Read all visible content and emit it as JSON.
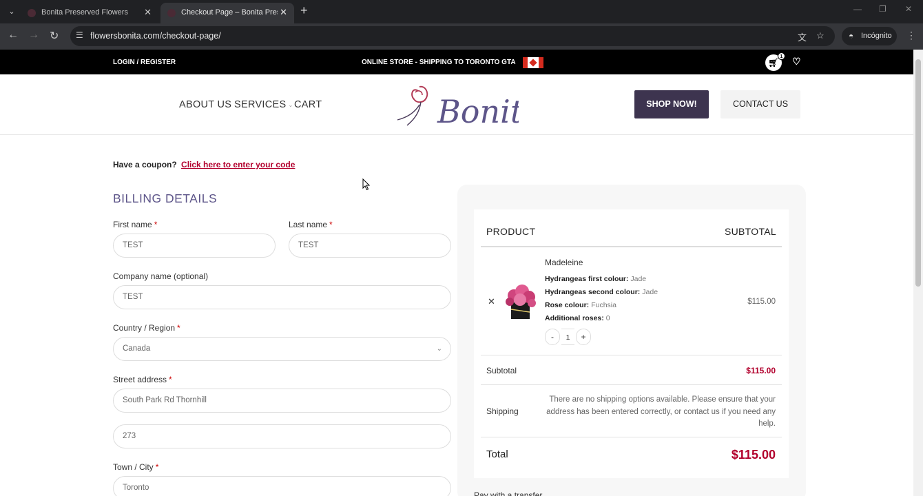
{
  "browser": {
    "tabs": [
      {
        "title": "Bonita Preserved Flowers",
        "active": false
      },
      {
        "title": "Checkout Page – Bonita Preserved Flowers",
        "active": true
      }
    ],
    "url": "flowersbonita.com/checkout-page/",
    "incognito_label": "Incógnito"
  },
  "topbar": {
    "login": "LOGIN / REGISTER",
    "promo": "ONLINE STORE - SHIPPING TO TORONTO GTA",
    "cart_count": "1"
  },
  "header": {
    "nav": [
      "ABOUT US",
      "SERVICES",
      "CART"
    ],
    "logo_text": "Bonita",
    "shop_button": "SHOP NOW!",
    "contact_button": "CONTACT US"
  },
  "coupon": {
    "prompt": "Have a coupon?",
    "link": "Click here to enter your code"
  },
  "billing": {
    "heading": "BILLING DETAILS",
    "first_name": {
      "label": "First name",
      "value": "TEST"
    },
    "last_name": {
      "label": "Last name",
      "value": "TEST"
    },
    "company": {
      "label": "Company name (optional)",
      "value": "TEST"
    },
    "country": {
      "label": "Country / Region",
      "value": "Canada"
    },
    "street": {
      "label": "Street address",
      "value": "South Park Rd Thornhill",
      "value2": "273"
    },
    "city": {
      "label": "Town / City",
      "value": "Toronto"
    }
  },
  "order": {
    "col_product": "PRODUCT",
    "col_subtotal": "SUBTOTAL",
    "item": {
      "name": "Madeleine",
      "attrs": [
        {
          "k": "Hydrangeas first colour:",
          "v": "Jade"
        },
        {
          "k": "Hydrangeas second colour:",
          "v": "Jade"
        },
        {
          "k": "Rose colour:",
          "v": "Fuchsia"
        },
        {
          "k": "Additional roses:",
          "v": "0"
        }
      ],
      "qty": "1",
      "minus": "-",
      "plus": "+",
      "price": "$115.00"
    },
    "subtotal_label": "Subtotal",
    "subtotal_value": "$115.00",
    "shipping_label": "Shipping",
    "shipping_message": "There are no shipping options available. Please ensure that your address has been entered correctly, or contact us if you need any help.",
    "total_label": "Total",
    "total_value": "$115.00",
    "pay_with": "Pay with a transfer"
  }
}
